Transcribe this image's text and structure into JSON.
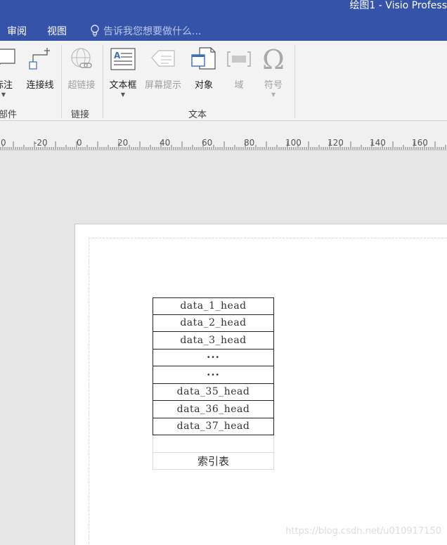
{
  "window": {
    "title": "绘图1 - Visio Profess"
  },
  "tabs": [
    {
      "label": "审阅"
    },
    {
      "label": "视图"
    }
  ],
  "tell_me": {
    "placeholder": "告诉我您想要做什么..."
  },
  "ribbon": {
    "buttons": {
      "callout": {
        "label": "标注"
      },
      "connector": {
        "label": "连接线"
      },
      "hyperlink": {
        "label": "超链接"
      },
      "textbox": {
        "label": "文本框"
      },
      "screentip": {
        "label": "屏幕提示"
      },
      "object": {
        "label": "对象"
      },
      "field": {
        "label": "域"
      },
      "symbol": {
        "label": "符号"
      }
    },
    "groups": {
      "parts": "部件",
      "links": "链接",
      "text": "文本"
    }
  },
  "ruler": {
    "labels": [
      "0",
      "-20",
      "0",
      "20",
      "40",
      "60",
      "80",
      "100",
      "120",
      "140",
      "160"
    ]
  },
  "drawing": {
    "index_rows": [
      "data_1_head",
      "data_2_head",
      "data_3_head",
      "···",
      "···",
      "data_35_head",
      "data_36_head",
      "data_37_head"
    ],
    "caption": "索引表"
  },
  "watermark": "https://blog.csdn.net/u010917150",
  "colors": {
    "titlebar": "#3553a8",
    "ribbon": "#f3f3f3",
    "canvas": "#e6e6e6"
  }
}
